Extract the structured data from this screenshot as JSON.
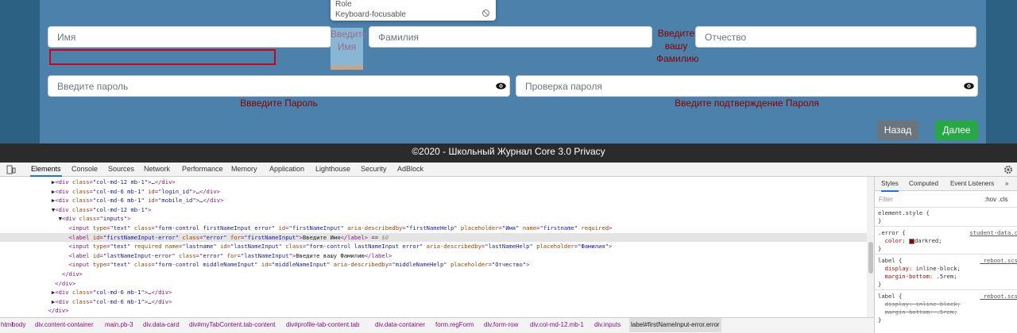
{
  "tooltip": {
    "role_label": "Role",
    "keyboard_label": "Keyboard-focusable",
    "icon": "no-entry-icon"
  },
  "form": {
    "first_name_placeholder": "Имя",
    "last_name_placeholder": "Фамилия",
    "middle_name_placeholder": "Отчество",
    "password_placeholder": "Введите пароль",
    "password_confirm_placeholder": "Проверка пароля",
    "first_name_error": "Введите Имя",
    "last_name_error": "Введите вашу Фамилию",
    "password_error": "Ввведите Пароль",
    "password_confirm_error": "Введите подтверждение Пароля",
    "back_label": "Назад",
    "next_label": "Далее"
  },
  "footer": {
    "text": "©2020 - Школьный Журнал Core 3.0 Privacy"
  },
  "devtools": {
    "tabs": [
      "Elements",
      "Console",
      "Sources",
      "Network",
      "Performance",
      "Memory",
      "Application",
      "Lighthouse",
      "Security",
      "AdBlock"
    ],
    "side_tabs": [
      "Styles",
      "Computed",
      "Event Listeners"
    ],
    "filter_placeholder": "Filter",
    "hov_cls": ":hov .cls",
    "more": "»",
    "breadcrumbs": [
      "html",
      "body",
      "div.content-container",
      "main.pb-3",
      "div.data-card",
      "div#myTabContent.tab-content",
      "div#profile-tab-content.tab",
      "div.data-container",
      "form.regForm",
      "div.form-row",
      "div.col-md-12.mb-1",
      "div.inputs",
      "label#firstNameInput-error.error"
    ],
    "styles": {
      "element_style": "element.style {",
      "rule1_selector": ".error {",
      "rule1_source": "student-data.c",
      "rule1_prop": "color:",
      "rule1_value": "darkred;",
      "rule2_selector": "label {",
      "rule2_source": "_reboot.scs",
      "rule2_prop1": "display:",
      "rule2_val1": "inline-block;",
      "rule2_prop2": "margin-bottom:",
      "rule2_val2": ".5rem;",
      "rule3_selector": "label {",
      "rule3_source": "_reboot.scs",
      "rule3_line1": "display: inline-block;",
      "rule3_line2": "margin-bottom: .5rem;",
      "close_brace": "}"
    }
  }
}
